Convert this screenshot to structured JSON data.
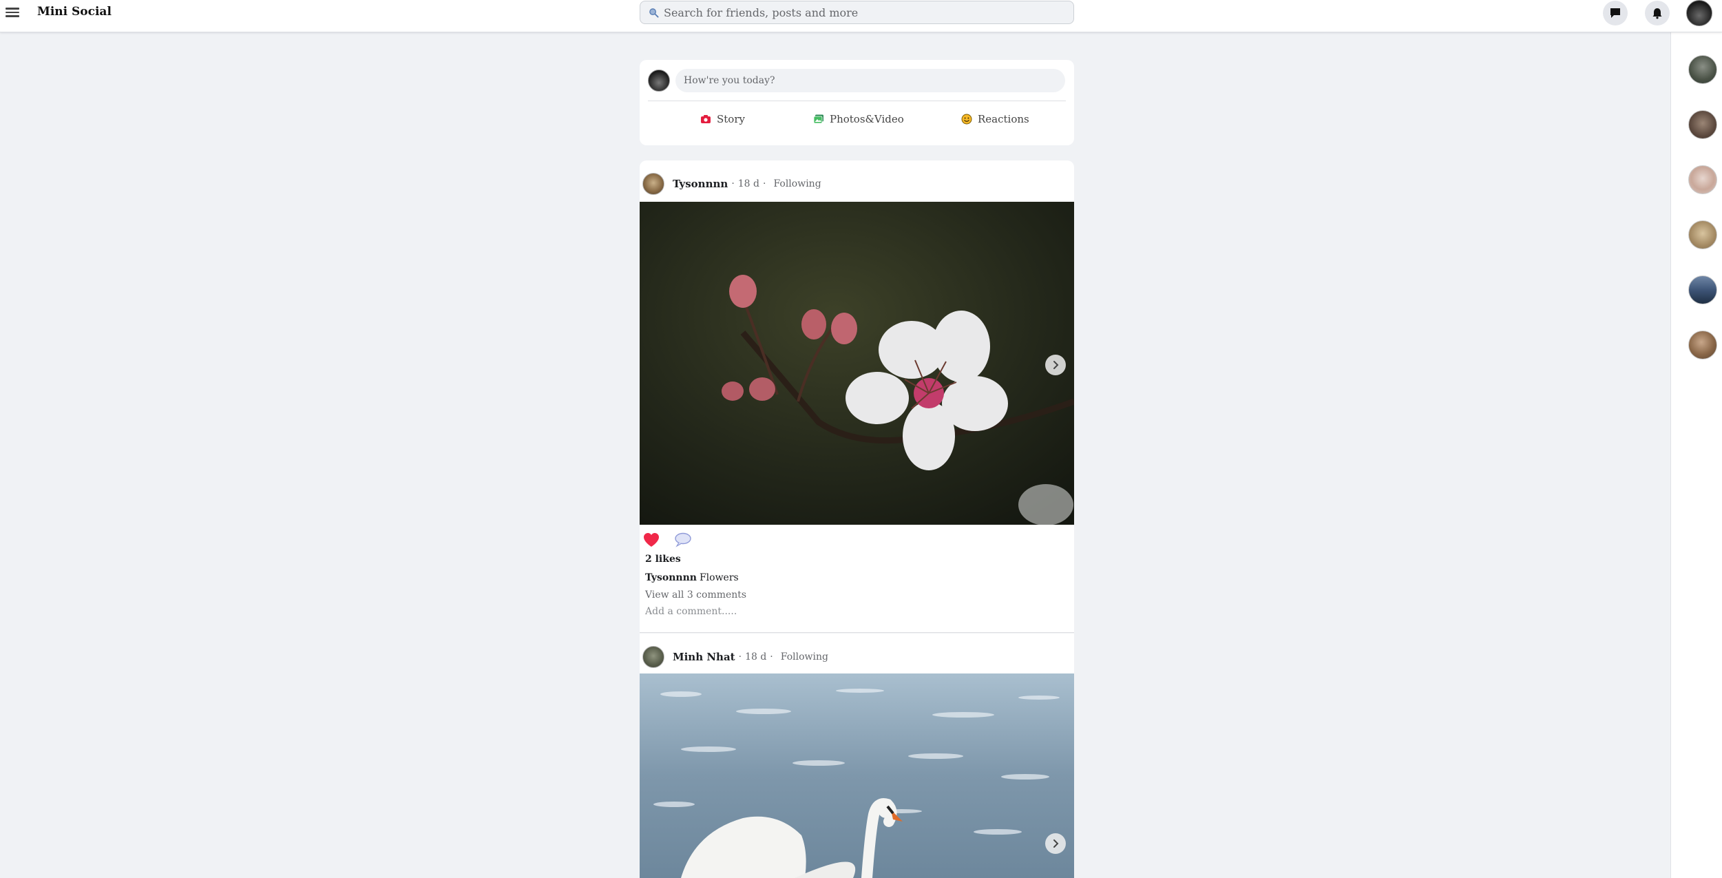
{
  "app": {
    "title": "Mini Social"
  },
  "search": {
    "placeholder": "Search for friends, posts and more"
  },
  "composer": {
    "placeholder": "How're you today?",
    "actions": [
      {
        "label": "Story",
        "icon": "camera-icon",
        "color": "#e41e3f"
      },
      {
        "label": "Photos&Video",
        "icon": "photos-icon",
        "color": "#45bd62"
      },
      {
        "label": "Reactions",
        "icon": "emoji-icon",
        "color": "#f7b928"
      }
    ]
  },
  "posts": [
    {
      "author": "Tysonnnn",
      "time": "18 d",
      "follow_status": "Following",
      "image": "white-blossom-photo",
      "likes": "2 likes",
      "caption_user": "Tysonnnn",
      "caption_text": "Flowers",
      "view_comments": "View all 3 comments",
      "add_comment_placeholder": "Add a comment....."
    },
    {
      "author": "Minh Nhat",
      "time": "18 d",
      "follow_status": "Following",
      "image": "white-swan-on-water-photo"
    }
  ],
  "right_rail": {
    "contacts_count": 6
  },
  "colors": {
    "heart": "#f02849",
    "accent": "#1877f2",
    "background": "#f0f2f5"
  }
}
